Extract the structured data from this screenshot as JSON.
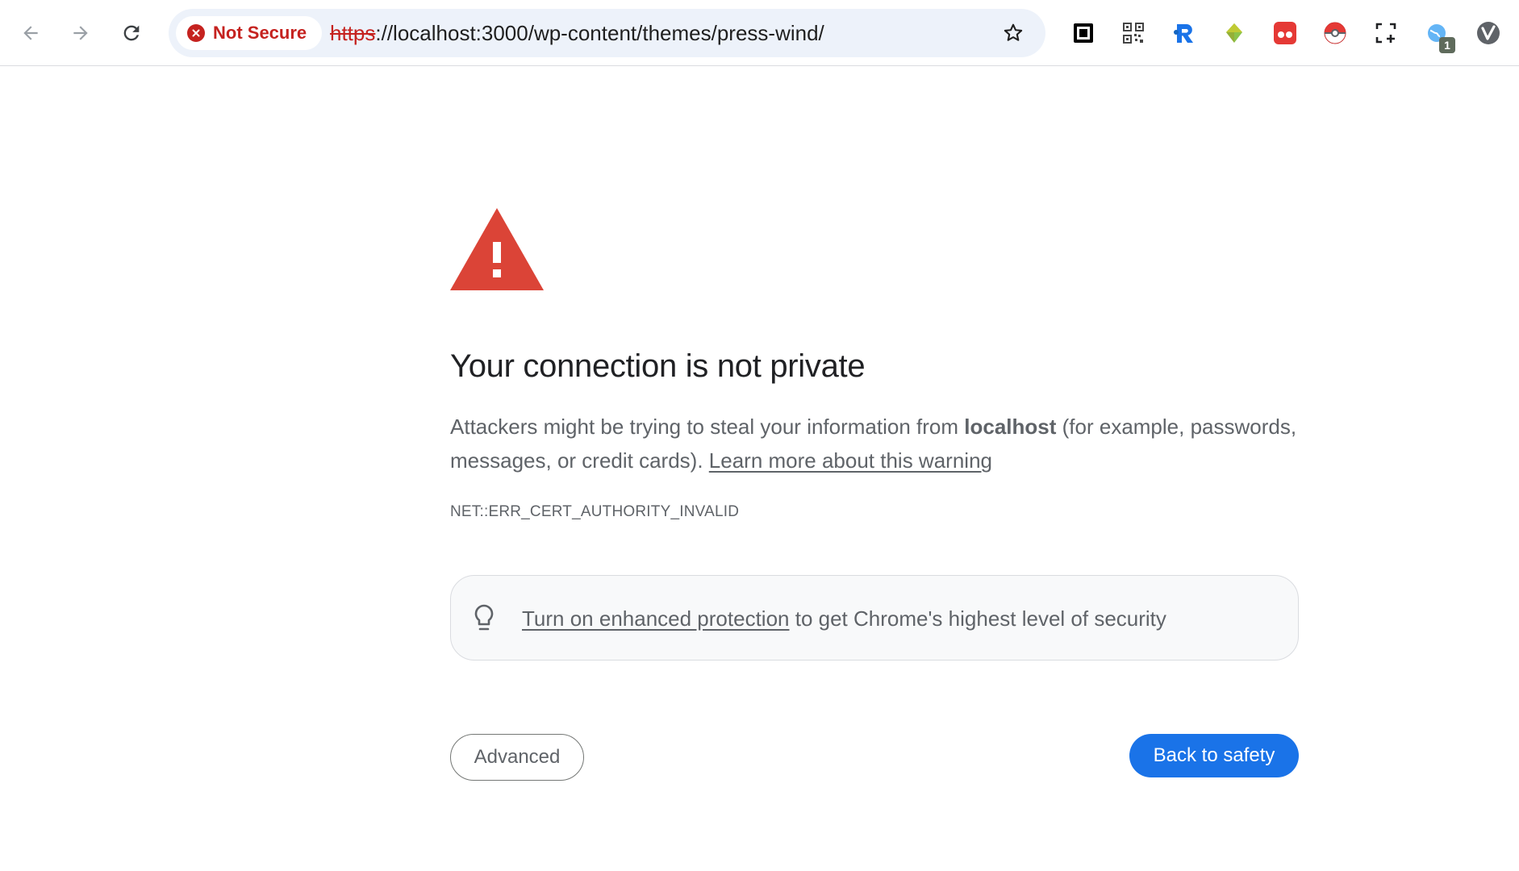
{
  "browser": {
    "security_chip": "Not Secure",
    "url_scheme": "https",
    "url_rest": "://localhost:3000/wp-content/themes/press-wind/",
    "extensions": [
      {
        "icon": "square-frame-icon"
      },
      {
        "icon": "qr-code-icon"
      },
      {
        "icon": "r-logo-icon"
      },
      {
        "icon": "gem-icon"
      },
      {
        "icon": "red-dots-icon"
      },
      {
        "icon": "pokeball-icon"
      },
      {
        "icon": "screenshot-crop-icon"
      },
      {
        "icon": "globe-badge-icon",
        "badge": "1"
      },
      {
        "icon": "v-logo-icon"
      }
    ]
  },
  "page": {
    "heading": "Your connection is not private",
    "body_prefix": "Attackers might be trying to steal your information from ",
    "body_host": "localhost",
    "body_suffix": " (for example, passwords, messages, or credit cards). ",
    "learn_more_link": "Learn more about this warning",
    "error_code": "NET::ERR_CERT_AUTHORITY_INVALID",
    "protection_link": "Turn on enhanced protection",
    "protection_text": " to get Chrome's highest level of security",
    "advanced_button": "Advanced",
    "back_button": "Back to safety"
  },
  "colors": {
    "warning_red": "#db4437",
    "not_secure_red": "#c5221f",
    "primary_blue": "#1a73e8"
  }
}
